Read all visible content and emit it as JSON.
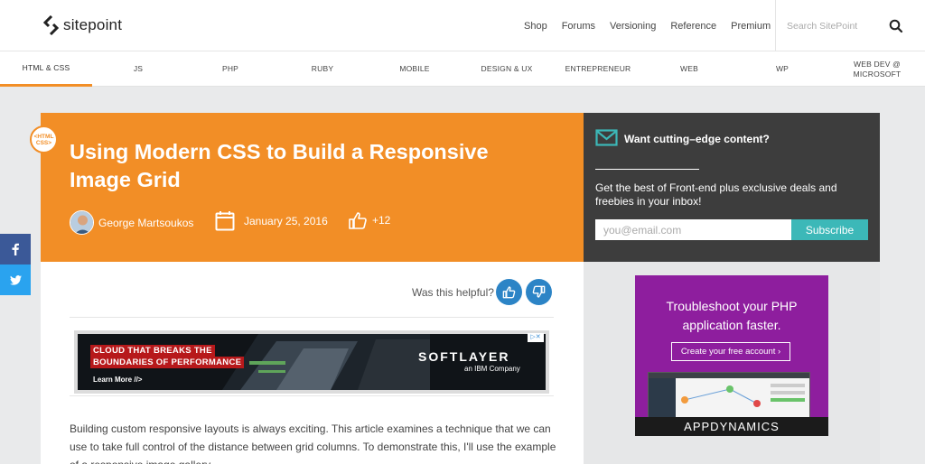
{
  "header": {
    "logo_text": "sitepoint",
    "nav": [
      "Shop",
      "Forums",
      "Versioning",
      "Reference",
      "Premium"
    ],
    "search_placeholder": "Search SitePoint"
  },
  "categories": [
    {
      "label": "HTML & CSS",
      "active": true
    },
    {
      "label": "JS"
    },
    {
      "label": "PHP"
    },
    {
      "label": "RUBY"
    },
    {
      "label": "MOBILE"
    },
    {
      "label": "DESIGN & UX"
    },
    {
      "label": "ENTREPRENEUR"
    },
    {
      "label": "WEB"
    },
    {
      "label": "WP"
    },
    {
      "label": "WEB DEV @ MICROSOFT"
    }
  ],
  "hero": {
    "badge": "<HTML CSS>",
    "title": "Using Modern CSS to Build a Responsive Image Grid",
    "author": "George Martsoukos",
    "date": "January 25, 2016",
    "likes": "+12",
    "bg_color": "#f28e26"
  },
  "subscribe": {
    "title": "Want cutting–edge content?",
    "text": "Get the best of Front-end plus exclusive deals and freebies in your inbox!",
    "email_placeholder": "you@email.com",
    "button": "Subscribe"
  },
  "article": {
    "helpful_label": "Was this helpful?",
    "body": "Building custom responsive layouts is always exciting. This article examines a technique that we can use to take full control of the distance between grid columns. To demonstrate this, I'll use the example of a responsive image gallery."
  },
  "banner_ad": {
    "line1": "CLOUD THAT BREAKS THE",
    "line2": "BOUNDARIES OF PERFORMANCE",
    "learn": "Learn More //>",
    "brand": "SOFTLAYER",
    "brand_sub": "an IBM Company"
  },
  "side_ad": {
    "title": "Troubleshoot your PHP application faster.",
    "button": "Create your free account",
    "brand": "APPDYNAMICS"
  },
  "colors": {
    "accent": "#f28e26",
    "teal": "#3cb8b8",
    "vote_blue": "#2c84c6",
    "facebook": "#3b5998",
    "twitter": "#2aa3ef"
  }
}
